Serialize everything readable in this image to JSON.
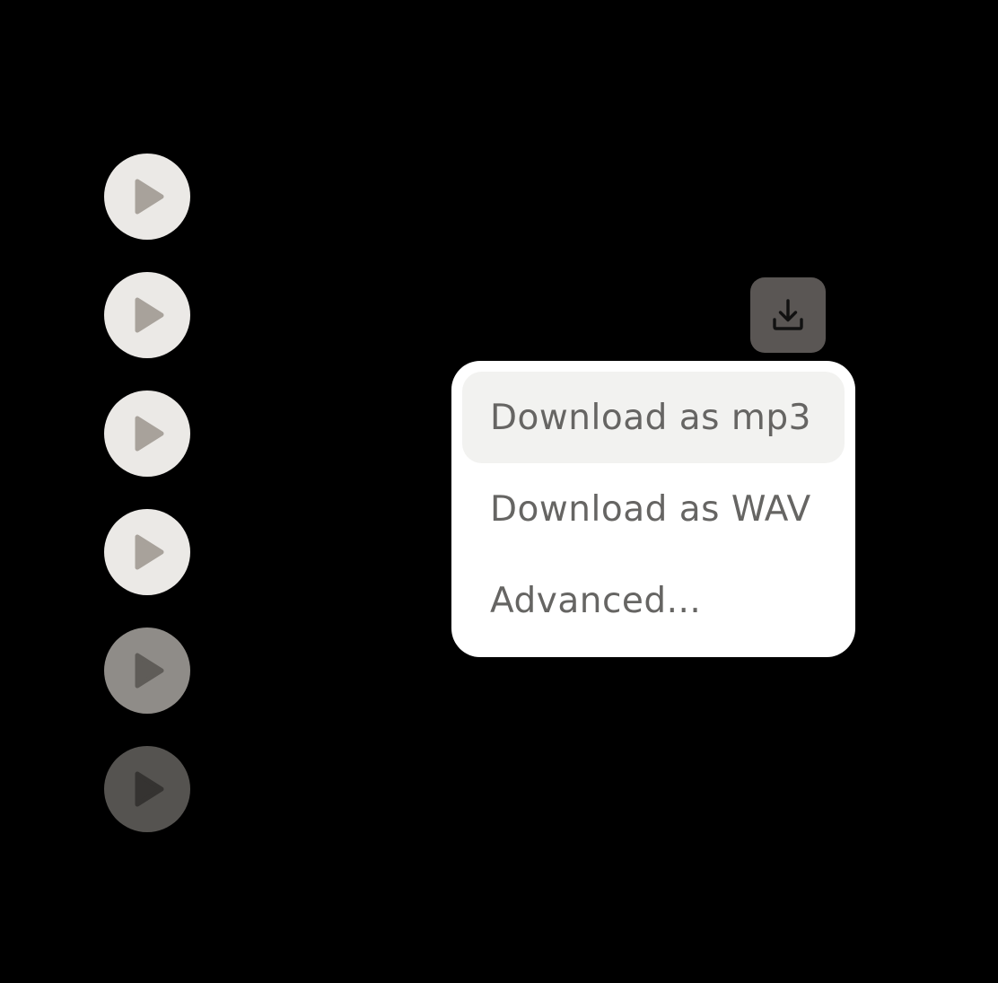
{
  "colors": {
    "background": "#000000",
    "menu_background": "#ffffff",
    "menu_highlight": "#f2f2f0",
    "menu_text": "#666563",
    "download_button_bg": "#5a5654",
    "download_icon": "#111111"
  },
  "tracks": [
    {
      "icon": "play-icon",
      "button_color": "#ebe9e6",
      "triangle_color": "#a8a29b"
    },
    {
      "icon": "play-icon",
      "button_color": "#ebe9e6",
      "triangle_color": "#a8a29b"
    },
    {
      "icon": "play-icon",
      "button_color": "#ebe9e6",
      "triangle_color": "#a8a29b"
    },
    {
      "icon": "play-icon",
      "button_color": "#ebe9e6",
      "triangle_color": "#a8a29b"
    },
    {
      "icon": "play-icon",
      "button_color": "#8f8c88",
      "triangle_color": "#5f5c58"
    },
    {
      "icon": "play-icon",
      "button_color": "#555350",
      "triangle_color": "#353331"
    }
  ],
  "download_button": {
    "icon": "download-icon"
  },
  "menu": {
    "items": [
      {
        "label": "Download as mp3",
        "highlighted": true
      },
      {
        "label": "Download as WAV",
        "highlighted": false
      },
      {
        "label": "Advanced...",
        "highlighted": false
      }
    ]
  }
}
